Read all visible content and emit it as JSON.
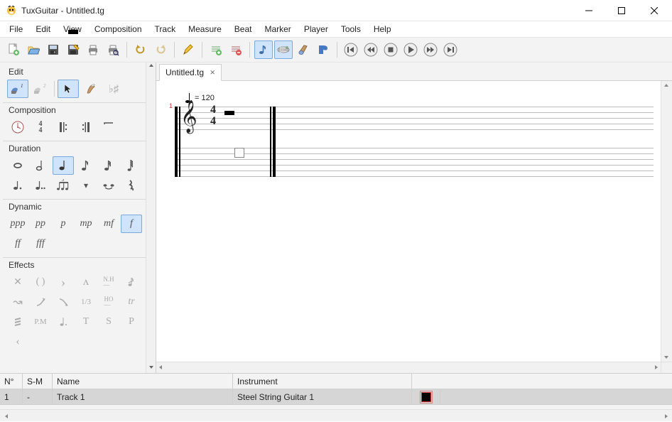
{
  "window": {
    "title": "TuxGuitar - Untitled.tg"
  },
  "menu": {
    "items": [
      "File",
      "Edit",
      "View",
      "Composition",
      "Track",
      "Measure",
      "Beat",
      "Marker",
      "Player",
      "Tools",
      "Help"
    ]
  },
  "toolbar": {
    "groups": [
      [
        "new",
        "open",
        "save",
        "save-as",
        "print",
        "print-preview"
      ],
      [
        "undo",
        "redo"
      ],
      [
        "edit-mode"
      ],
      [
        "add-track",
        "remove-track"
      ],
      [
        "show-score",
        "show-tablature",
        "show-fretboard",
        "show-transport"
      ],
      [
        "first",
        "rewind",
        "stop",
        "play",
        "forward",
        "last"
      ]
    ]
  },
  "sidebar": {
    "sections": {
      "edit": {
        "title": "Edit",
        "items": [
          "voice1",
          "voice2",
          "select",
          "free",
          "sharpflat"
        ],
        "selected": [
          "voice1",
          "select"
        ]
      },
      "composition": {
        "title": "Composition",
        "items": [
          "tempo",
          "timesig",
          "repeat-open",
          "repeat-close",
          "repeat-alt"
        ]
      },
      "duration": {
        "title": "Duration",
        "items": [
          "whole",
          "half",
          "quarter",
          "eighth",
          "sixteenth",
          "thirtysecond",
          "dotted",
          "double-dotted",
          "tuplet",
          "tuplet-custom",
          "tied",
          "rest"
        ],
        "selected": [
          "quarter"
        ]
      },
      "dynamic": {
        "title": "Dynamic",
        "items": [
          "ppp",
          "pp",
          "p",
          "mp",
          "mf",
          "f",
          "ff",
          "fff"
        ],
        "selected": [
          "f"
        ]
      },
      "effects": {
        "title": "Effects",
        "items": [
          "dead",
          "ghost",
          "accent",
          "heavy-accent",
          "nh",
          "grace",
          "bend",
          "slide",
          "hammer",
          "fraction",
          "ho",
          "trill",
          "tremolo",
          "pm",
          "vibrato",
          "t",
          "s",
          "p2",
          "fade"
        ]
      }
    }
  },
  "document": {
    "tab_label": "Untitled.tg",
    "tempo": "= 120",
    "measure_number": "1",
    "time_top": "4",
    "time_bottom": "4"
  },
  "tracks": {
    "headers": {
      "num": "N°",
      "sm": "S-M",
      "name": "Name",
      "instrument": "Instrument"
    },
    "rows": [
      {
        "num": "1",
        "sm": "-",
        "name": "Track 1",
        "instrument": "Steel String Guitar 1"
      }
    ]
  }
}
